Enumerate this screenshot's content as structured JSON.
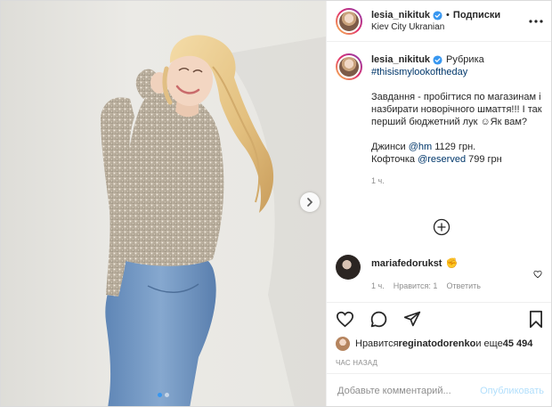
{
  "post": {
    "author": {
      "username": "lesia_nikituk",
      "verified": true,
      "follow_label": "Подписки",
      "location": "Kiev City Ukranian"
    },
    "caption": {
      "username": "lesia_nikituk",
      "rubric_label": "Рубрика",
      "hashtag": "#thisismylookoftheday",
      "body": "Завдання - пробігтися по магазинам і назбирати новорічного шмаття!!! І так перший бюджетний лук ☺Як вам?",
      "line_jeans_prefix": "Джинси ",
      "line_jeans_mention": "@hm",
      "line_jeans_suffix": " 1129 грн.",
      "line_top_prefix": "Кофточка ",
      "line_top_mention": "@reserved",
      "line_top_suffix": " 799 грн",
      "time": "1 ч."
    },
    "comment": {
      "username": "mariafedorukst",
      "emoji": "✊",
      "time": "1 ч.",
      "likes": "Нравится: 1",
      "reply": "Ответить"
    },
    "likes": {
      "prefix": "Нравится ",
      "user": "reginatodorenko",
      "middle": " и еще ",
      "count": "45 494"
    },
    "time_ago": "ЧАС НАЗАД",
    "input": {
      "placeholder": "Добавьте комментарий...",
      "publish_label": "Опубликовать"
    },
    "carousel": {
      "slides": 2,
      "active": 1
    },
    "icons": {
      "verified": "verified-badge-icon",
      "more": "more-horizontal-icon",
      "next": "chevron-right-icon",
      "load_more": "plus-circle-icon",
      "comment_like": "heart-outline-icon",
      "like": "heart-icon",
      "comment": "comment-bubble-icon",
      "share": "paper-plane-icon",
      "save": "bookmark-icon"
    },
    "colors": {
      "verified": "#3897f0",
      "link": "#00376b",
      "muted": "#8e8e8e",
      "publish": "#b2dffc"
    }
  }
}
